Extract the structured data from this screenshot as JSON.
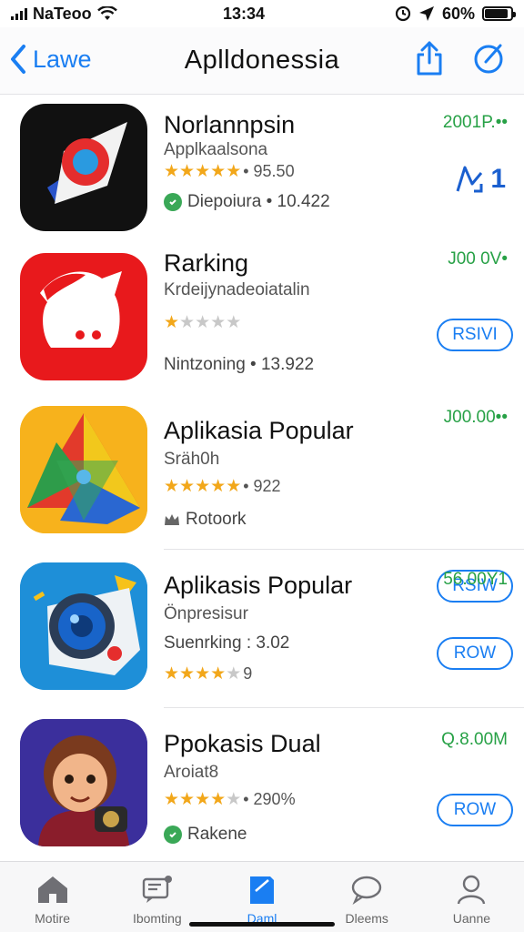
{
  "status_bar": {
    "carrier": "NaTeoo",
    "time": "13:34",
    "battery": "60%",
    "battery_level": 0.9
  },
  "nav": {
    "back_label": "Lawe",
    "title": "Aplldonessia",
    "share_icon": "share-icon",
    "compose_icon": "compose-icon"
  },
  "apps": [
    {
      "name": "Norlannpsin",
      "subtitle": "Applkaalsona",
      "rating_stars": 4.5,
      "rating_text": "• 95.50",
      "meta_text": "Diepoiura • 10.422",
      "meta_icon": "check-badge-icon",
      "price": "2001P.••",
      "action_text": "1"
    },
    {
      "name": "Rarking",
      "subtitle": "Krdeijynadeoiatalin",
      "rating_stars": 1,
      "rating_text": "",
      "meta_text": "Nintzoning • 13.922",
      "price": "J00 0V•",
      "action_text": "RSIVI"
    },
    {
      "name": "Aplikasia Popular",
      "subtitle": "Sräh0h",
      "rating_stars": 4.5,
      "rating_text": "• 922",
      "meta_text": "Rotoork",
      "meta_icon": "crown-icon",
      "price": "J00.00••",
      "action_text": "RSIW"
    },
    {
      "name": "Aplikasis Popular",
      "subtitle": "Önpresisur",
      "rating_stars": 4,
      "rating_text": "9",
      "meta_text": "Suenrking : 3.02",
      "price": "56.00Y1",
      "action_text": "ROW"
    },
    {
      "name": "Ppokasis Dual",
      "subtitle": "Aroiat8",
      "rating_stars": 4,
      "rating_text": "• 290%",
      "meta_text": "Rakene",
      "meta_icon": "check-badge-icon",
      "price": "Q.8.00M",
      "action_text": "ROW"
    }
  ],
  "tabs": [
    {
      "label": "Motire",
      "icon": "home-icon"
    },
    {
      "label": "Ibomting",
      "icon": "chat-bubble-icon"
    },
    {
      "label": "Daml",
      "icon": "bookmark-icon",
      "active": true
    },
    {
      "label": "Dleems",
      "icon": "speech-bubble-icon"
    },
    {
      "label": "Uanne",
      "icon": "person-icon"
    }
  ],
  "colors": {
    "accent": "#1a7ef2",
    "price_green": "#27a146",
    "star": "#f2a71a"
  }
}
